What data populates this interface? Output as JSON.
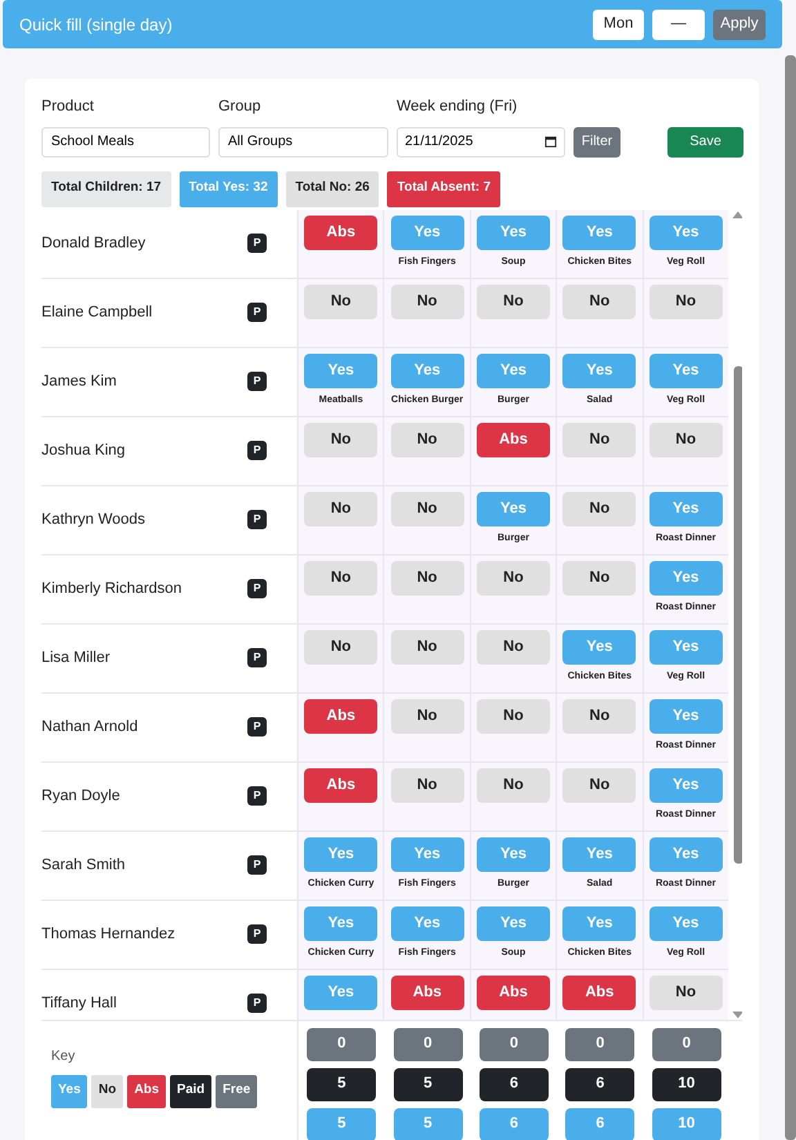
{
  "quick_fill": {
    "title": "Quick fill (single day)",
    "day": "Mon",
    "value": "—",
    "apply": "Apply"
  },
  "filters": {
    "product_label": "Product",
    "product": "School Meals",
    "group_label": "Group",
    "group": "All Groups",
    "week_label": "Week ending (Fri)",
    "week": "21/11/2025",
    "filter_button": "Filter",
    "save_button": "Save"
  },
  "totals": [
    {
      "kind": "children",
      "label": "Total Children: 17"
    },
    {
      "kind": "yes",
      "label": "Total Yes: 32"
    },
    {
      "kind": "no",
      "label": "Total No: 26"
    },
    {
      "kind": "abs",
      "label": "Total Absent: 7"
    }
  ],
  "rows": [
    {
      "name": "Donald Bradley",
      "badge": "P",
      "cells": [
        {
          "kind": "abs",
          "label": "Abs"
        },
        {
          "kind": "yes",
          "label": "Yes",
          "meal": "Fish Fingers"
        },
        {
          "kind": "yes",
          "label": "Yes",
          "meal": "Soup"
        },
        {
          "kind": "yes",
          "label": "Yes",
          "meal": "Chicken Bites"
        },
        {
          "kind": "yes",
          "label": "Yes",
          "meal": "Veg Roll"
        }
      ]
    },
    {
      "name": "Elaine Campbell",
      "badge": "P",
      "cells": [
        {
          "kind": "no",
          "label": "No"
        },
        {
          "kind": "no",
          "label": "No"
        },
        {
          "kind": "no",
          "label": "No"
        },
        {
          "kind": "no",
          "label": "No"
        },
        {
          "kind": "no",
          "label": "No"
        }
      ]
    },
    {
      "name": "James Kim",
      "badge": "P",
      "cells": [
        {
          "kind": "yes",
          "label": "Yes",
          "meal": "Meatballs"
        },
        {
          "kind": "yes",
          "label": "Yes",
          "meal": "Chicken Burger"
        },
        {
          "kind": "yes",
          "label": "Yes",
          "meal": "Burger"
        },
        {
          "kind": "yes",
          "label": "Yes",
          "meal": "Salad"
        },
        {
          "kind": "yes",
          "label": "Yes",
          "meal": "Veg Roll"
        }
      ]
    },
    {
      "name": "Joshua King",
      "badge": "P",
      "cells": [
        {
          "kind": "no",
          "label": "No"
        },
        {
          "kind": "no",
          "label": "No"
        },
        {
          "kind": "abs",
          "label": "Abs"
        },
        {
          "kind": "no",
          "label": "No"
        },
        {
          "kind": "no",
          "label": "No"
        }
      ]
    },
    {
      "name": "Kathryn Woods",
      "badge": "P",
      "cells": [
        {
          "kind": "no",
          "label": "No"
        },
        {
          "kind": "no",
          "label": "No"
        },
        {
          "kind": "yes",
          "label": "Yes",
          "meal": "Burger"
        },
        {
          "kind": "no",
          "label": "No"
        },
        {
          "kind": "yes",
          "label": "Yes",
          "meal": "Roast Dinner"
        }
      ]
    },
    {
      "name": "Kimberly Richardson",
      "badge": "P",
      "cells": [
        {
          "kind": "no",
          "label": "No"
        },
        {
          "kind": "no",
          "label": "No"
        },
        {
          "kind": "no",
          "label": "No"
        },
        {
          "kind": "no",
          "label": "No"
        },
        {
          "kind": "yes",
          "label": "Yes",
          "meal": "Roast Dinner"
        }
      ]
    },
    {
      "name": "Lisa Miller",
      "badge": "P",
      "cells": [
        {
          "kind": "no",
          "label": "No"
        },
        {
          "kind": "no",
          "label": "No"
        },
        {
          "kind": "no",
          "label": "No"
        },
        {
          "kind": "yes",
          "label": "Yes",
          "meal": "Chicken Bites"
        },
        {
          "kind": "yes",
          "label": "Yes",
          "meal": "Veg Roll"
        }
      ]
    },
    {
      "name": "Nathan Arnold",
      "badge": "P",
      "cells": [
        {
          "kind": "abs",
          "label": "Abs"
        },
        {
          "kind": "no",
          "label": "No"
        },
        {
          "kind": "no",
          "label": "No"
        },
        {
          "kind": "no",
          "label": "No"
        },
        {
          "kind": "yes",
          "label": "Yes",
          "meal": "Roast Dinner"
        }
      ]
    },
    {
      "name": "Ryan Doyle",
      "badge": "P",
      "cells": [
        {
          "kind": "abs",
          "label": "Abs"
        },
        {
          "kind": "no",
          "label": "No"
        },
        {
          "kind": "no",
          "label": "No"
        },
        {
          "kind": "no",
          "label": "No"
        },
        {
          "kind": "yes",
          "label": "Yes",
          "meal": "Roast Dinner"
        }
      ]
    },
    {
      "name": "Sarah Smith",
      "badge": "P",
      "cells": [
        {
          "kind": "yes",
          "label": "Yes",
          "meal": "Chicken Curry"
        },
        {
          "kind": "yes",
          "label": "Yes",
          "meal": "Fish Fingers"
        },
        {
          "kind": "yes",
          "label": "Yes",
          "meal": "Burger"
        },
        {
          "kind": "yes",
          "label": "Yes",
          "meal": "Salad"
        },
        {
          "kind": "yes",
          "label": "Yes",
          "meal": "Roast Dinner"
        }
      ]
    },
    {
      "name": "Thomas Hernandez",
      "badge": "P",
      "cells": [
        {
          "kind": "yes",
          "label": "Yes",
          "meal": "Chicken Curry"
        },
        {
          "kind": "yes",
          "label": "Yes",
          "meal": "Fish Fingers"
        },
        {
          "kind": "yes",
          "label": "Yes",
          "meal": "Soup"
        },
        {
          "kind": "yes",
          "label": "Yes",
          "meal": "Chicken Bites"
        },
        {
          "kind": "yes",
          "label": "Yes",
          "meal": "Veg Roll"
        }
      ]
    },
    {
      "name": "Tiffany Hall",
      "badge": "P",
      "cells": [
        {
          "kind": "yes",
          "label": "Yes"
        },
        {
          "kind": "abs",
          "label": "Abs"
        },
        {
          "kind": "abs",
          "label": "Abs"
        },
        {
          "kind": "abs",
          "label": "Abs"
        },
        {
          "kind": "no",
          "label": "No"
        }
      ]
    }
  ],
  "key": {
    "title": "Key",
    "items": [
      {
        "kind": "yes",
        "label": "Yes"
      },
      {
        "kind": "no",
        "label": "No"
      },
      {
        "kind": "abs",
        "label": "Abs"
      },
      {
        "kind": "paid",
        "label": "Paid"
      },
      {
        "kind": "free",
        "label": "Free"
      }
    ]
  },
  "summary": [
    {
      "kind": "free",
      "values": [
        "0",
        "0",
        "0",
        "0",
        "0"
      ]
    },
    {
      "kind": "paid",
      "values": [
        "5",
        "5",
        "6",
        "6",
        "10"
      ]
    },
    {
      "kind": "yes",
      "values": [
        "5",
        "5",
        "6",
        "6",
        "10"
      ]
    }
  ]
}
